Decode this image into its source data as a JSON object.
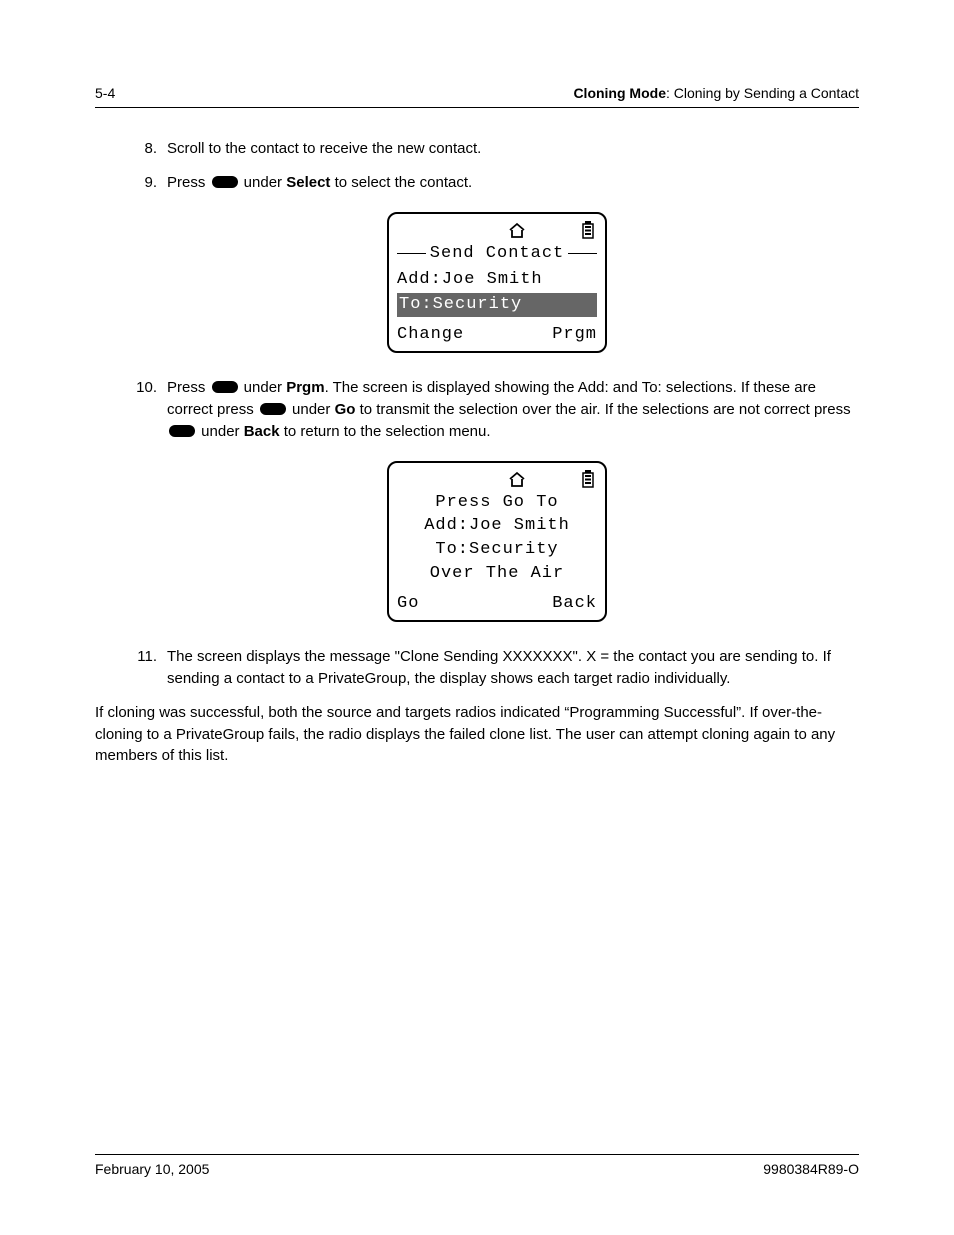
{
  "header": {
    "page_num": "5-4",
    "section_bold": "Cloning Mode",
    "section_rest": ": Cloning by Sending a Contact"
  },
  "steps": {
    "s8": {
      "num": "8.",
      "text": "Scroll to the contact to receive the new contact."
    },
    "s9": {
      "num": "9.",
      "pre": "Press ",
      "mid": " under ",
      "bold": "Select",
      "post": " to select the contact."
    },
    "s10": {
      "num": "10.",
      "p1_pre": "Press ",
      "p1_mid": " under ",
      "p1_bold": "Prgm",
      "p1_post": ". The screen is displayed showing the Add: and To: selections. If these are correct press ",
      "p2_mid": " under ",
      "p2_bold": "Go",
      "p2_post": " to transmit the selection over the air. If the selections are not correct press ",
      "p3_mid": " under ",
      "p3_bold": "Back",
      "p3_post": " to return to the selection menu."
    },
    "s11": {
      "num": "11.",
      "text": "The screen displays the message \"Clone Sending XXXXXXX\". X = the contact you are sending to. If sending a contact to a PrivateGroup, the display shows each target radio individually."
    }
  },
  "lcd1": {
    "title": "Send Contact",
    "line1": "Add:Joe Smith",
    "line2": "To:Security",
    "sk_left": "Change",
    "sk_right": "Prgm"
  },
  "lcd2": {
    "line1": "Press Go To",
    "line2": "Add:Joe Smith",
    "line3": "To:Security",
    "line4": "Over The Air",
    "sk_left": "Go",
    "sk_right": "Back"
  },
  "closing_para": "If cloning was successful, both the source and targets radios indicated “Programming Successful”. If over-the-cloning to a PrivateGroup fails, the radio displays the failed clone list. The user can attempt cloning again to any members of this list.",
  "footer": {
    "date": "February 10, 2005",
    "docnum": "9980384R89-O"
  }
}
